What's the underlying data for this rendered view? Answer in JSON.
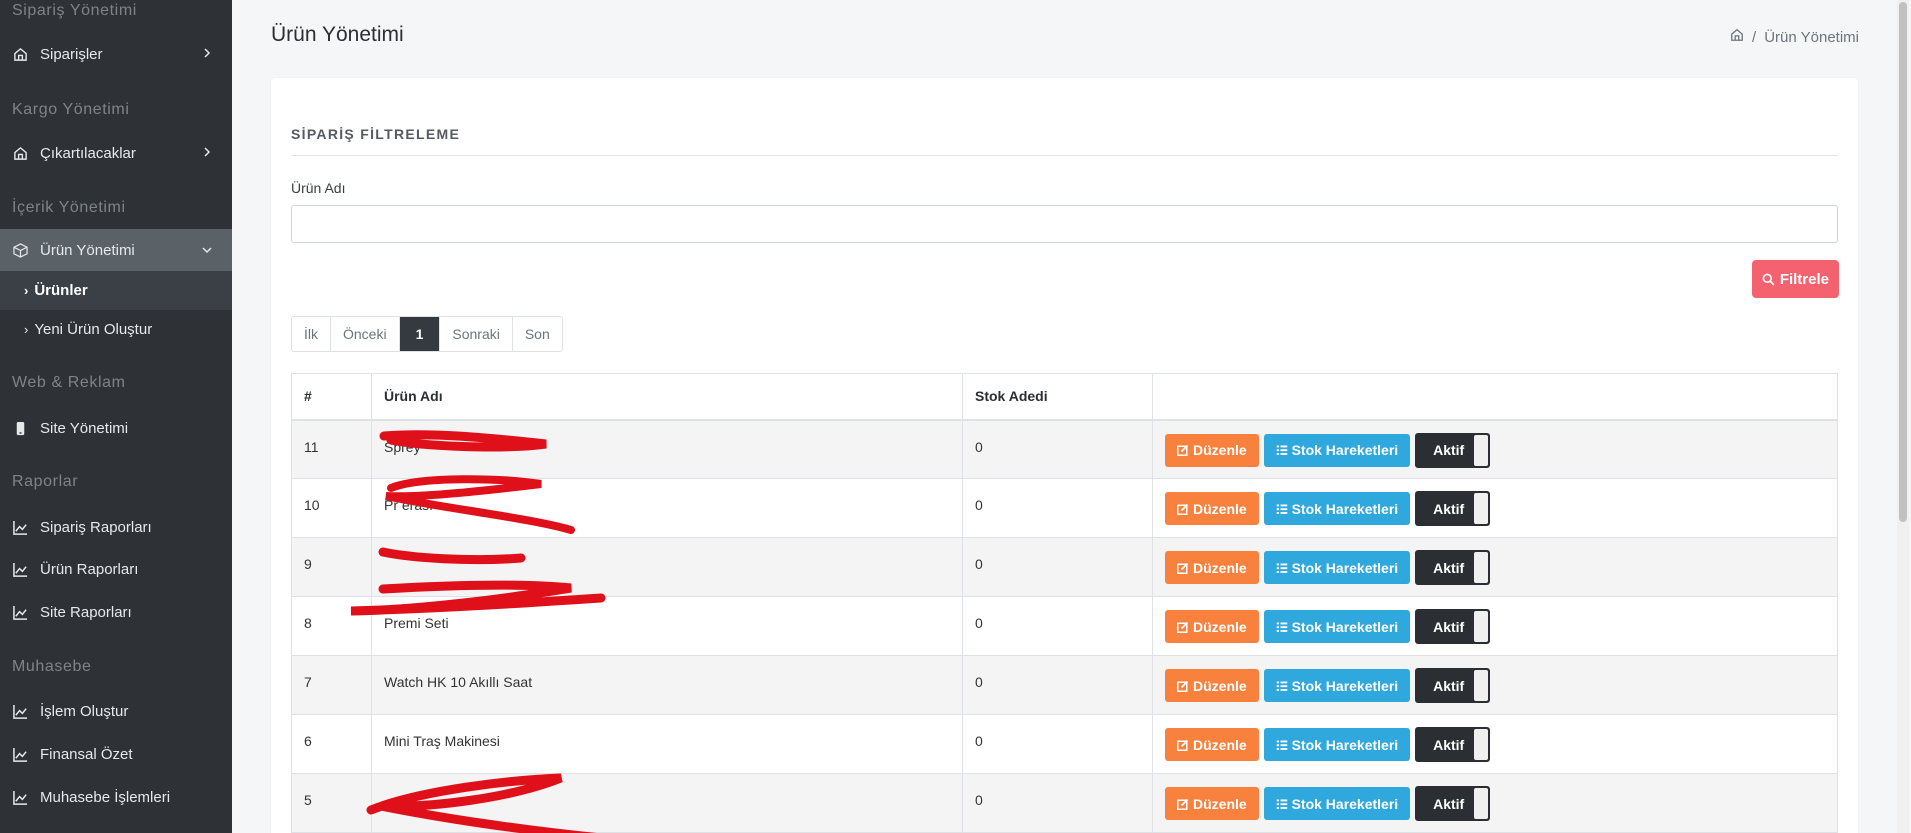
{
  "sidebar": {
    "sections": [
      {
        "heading": "Sipariş Yönetimi",
        "items": [
          {
            "label": "Siparişler",
            "icon": "home-icon"
          }
        ]
      },
      {
        "heading": "Kargo Yönetimi",
        "items": [
          {
            "label": "Çıkartılacaklar",
            "icon": "home-icon"
          }
        ]
      },
      {
        "heading": "İçerik Yönetimi",
        "items": [
          {
            "label": "Ürün Yönetimi",
            "icon": "box-icon"
          }
        ]
      },
      {
        "heading": "Web & Reklam",
        "items": [
          {
            "label": "Site Yönetimi",
            "icon": "mobile-icon"
          }
        ]
      },
      {
        "heading": "Raporlar",
        "items": [
          {
            "label": "Sipariş Raporları",
            "icon": "chart-icon"
          },
          {
            "label": "Ürün Raporları",
            "icon": "chart-icon"
          },
          {
            "label": "Site Raporları",
            "icon": "chart-icon"
          }
        ]
      },
      {
        "heading": "Muhasebe",
        "items": [
          {
            "label": "İşlem Oluştur",
            "icon": "chart-icon"
          },
          {
            "label": "Finansal Özet",
            "icon": "chart-icon"
          },
          {
            "label": "Muhasebe İşlemleri",
            "icon": "chart-icon"
          }
        ]
      }
    ],
    "subitems": [
      {
        "label": "Ürünler",
        "active": true
      },
      {
        "label": "Yeni Ürün Oluştur",
        "active": false
      }
    ]
  },
  "header": {
    "title": "Ürün Yönetimi",
    "breadcrumb_sep": "/",
    "breadcrumb_current": "Ürün Yönetimi"
  },
  "filter": {
    "section_title": "SİPARİŞ FİLTRELEME",
    "field_label": "Ürün Adı",
    "field_value": "",
    "button_label": "Filtrele"
  },
  "pagination": {
    "first": "İlk",
    "prev": "Önceki",
    "current": "1",
    "next": "Sonraki",
    "last": "Son"
  },
  "table": {
    "headers": [
      "#",
      "Ürün Adı",
      "Stok Adedi",
      ""
    ],
    "edit_label": "Düzenle",
    "stock_label": "Stok Hareketleri",
    "status_label": "Aktif",
    "rows": [
      {
        "id": "11",
        "name": "Sprey",
        "stock": "0",
        "redacted": true
      },
      {
        "id": "10",
        "name": "Pr erası",
        "stock": "0",
        "redacted": true
      },
      {
        "id": "9",
        "name": "",
        "stock": "0",
        "redacted": true
      },
      {
        "id": "8",
        "name": "Premi Seti",
        "stock": "0",
        "redacted": true
      },
      {
        "id": "7",
        "name": "Watch HK 10 Akıllı Saat",
        "stock": "0",
        "redacted": false
      },
      {
        "id": "6",
        "name": "Mini Traş Makinesi",
        "stock": "0",
        "redacted": false
      },
      {
        "id": "5",
        "name": "",
        "stock": "0",
        "redacted": true
      }
    ]
  },
  "colors": {
    "sidebar_bg": "#2e3236",
    "active_item": "#5a6268",
    "filter_btn": "#f5626f",
    "edit_btn": "#f7813d",
    "stock_btn": "#2fa8dd",
    "toggle_bg": "#2b2f33",
    "redaction": "#e0101a"
  }
}
